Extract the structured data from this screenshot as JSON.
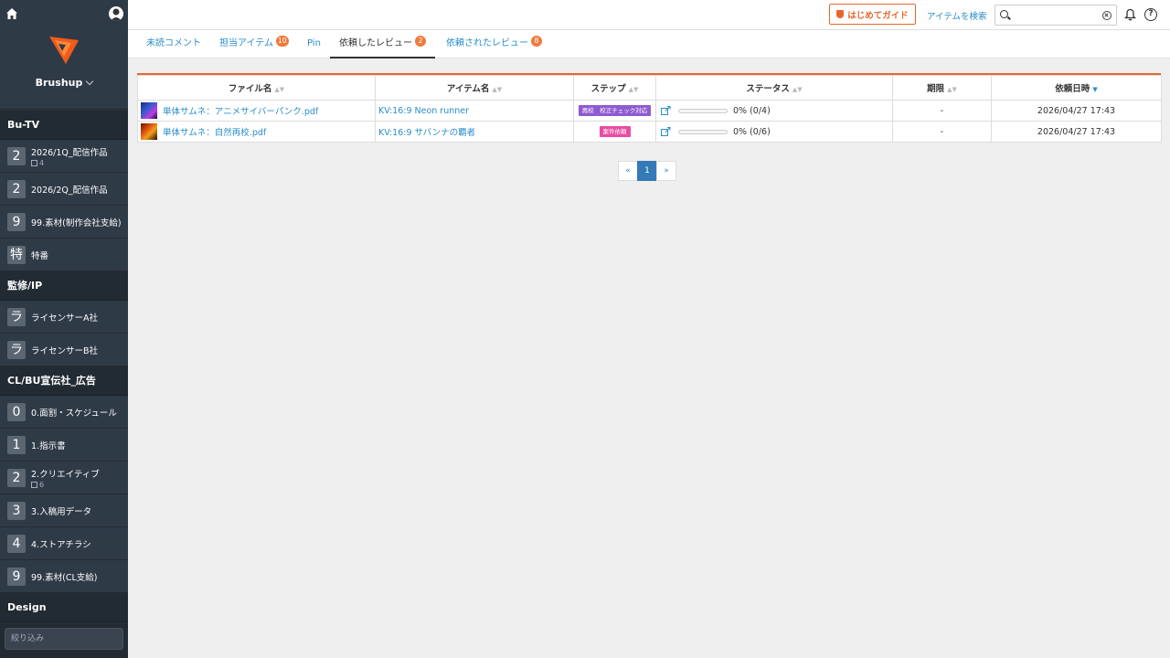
{
  "sidebar": {
    "brand": "Brushup",
    "sections": [
      {
        "title": "Bu-TV",
        "items": [
          {
            "badge": "2",
            "label": "2026/1Q_配信作品",
            "sub": "4"
          },
          {
            "badge": "2",
            "label": "2026/2Q_配信作品",
            "sub": ""
          },
          {
            "badge": "9",
            "label": "99.素材(制作会社支給)",
            "sub": ""
          },
          {
            "badge": "特",
            "label": "特番",
            "sub": ""
          }
        ]
      },
      {
        "title": "監修/IP",
        "items": [
          {
            "badge": "ラ",
            "label": "ライセンサーA社",
            "sub": ""
          },
          {
            "badge": "ラ",
            "label": "ライセンサーB社",
            "sub": ""
          }
        ]
      },
      {
        "title": "CL/BU宣伝社_広告",
        "items": [
          {
            "badge": "0",
            "label": "0.面割・スケジュール",
            "sub": ""
          },
          {
            "badge": "1",
            "label": "1.指示書",
            "sub": ""
          },
          {
            "badge": "2",
            "label": "2.クリエイティブ",
            "sub": "6"
          },
          {
            "badge": "3",
            "label": "3.入稿用データ",
            "sub": ""
          },
          {
            "badge": "4",
            "label": "4.ストアチラシ",
            "sub": ""
          },
          {
            "badge": "9",
            "label": "99.素材(CL支給)",
            "sub": ""
          }
        ]
      },
      {
        "title": "Design",
        "items": []
      }
    ],
    "filter_placeholder": "絞り込み"
  },
  "header": {
    "guide_label": "はじめてガイド",
    "search_link": "アイテムを検索",
    "search_value": "",
    "help_label": "?"
  },
  "tabs": [
    {
      "label": "未読コメント",
      "count": ""
    },
    {
      "label": "担当アイテム",
      "count": "10"
    },
    {
      "label": "Pin",
      "count": ""
    },
    {
      "label": "依頼したレビュー",
      "count": "2"
    },
    {
      "label": "依頼されたレビュー",
      "count": "8"
    }
  ],
  "table": {
    "columns": [
      "ファイル名",
      "アイテム名",
      "ステップ",
      "ステータス",
      "期限",
      "依頼日時"
    ],
    "rows": [
      {
        "file": "単体サムネ：アニメサイバーパンク.pdf",
        "item": "KV:16:9 Neon runner",
        "step": "再校　校正チェック対応",
        "step_color": "#8e5bd0",
        "progress": 0,
        "status": "0%  (0/4)",
        "due": "-",
        "date": "2026/04/27 17:43"
      },
      {
        "file": "単体サムネ：自然再校.pdf",
        "item": "KV:16:9 サバンナの覇者",
        "step": "案件依頼",
        "step_color": "#e84ca0",
        "progress": 0,
        "status": "0%  (0/6)",
        "due": "-",
        "date": "2026/04/27 17:43"
      }
    ]
  },
  "pager": {
    "prev": "«",
    "current": "1",
    "next": "»"
  },
  "colors": {
    "accent": "#e8662b",
    "link": "#2a8ec8",
    "sidebar": "#2b3440"
  }
}
